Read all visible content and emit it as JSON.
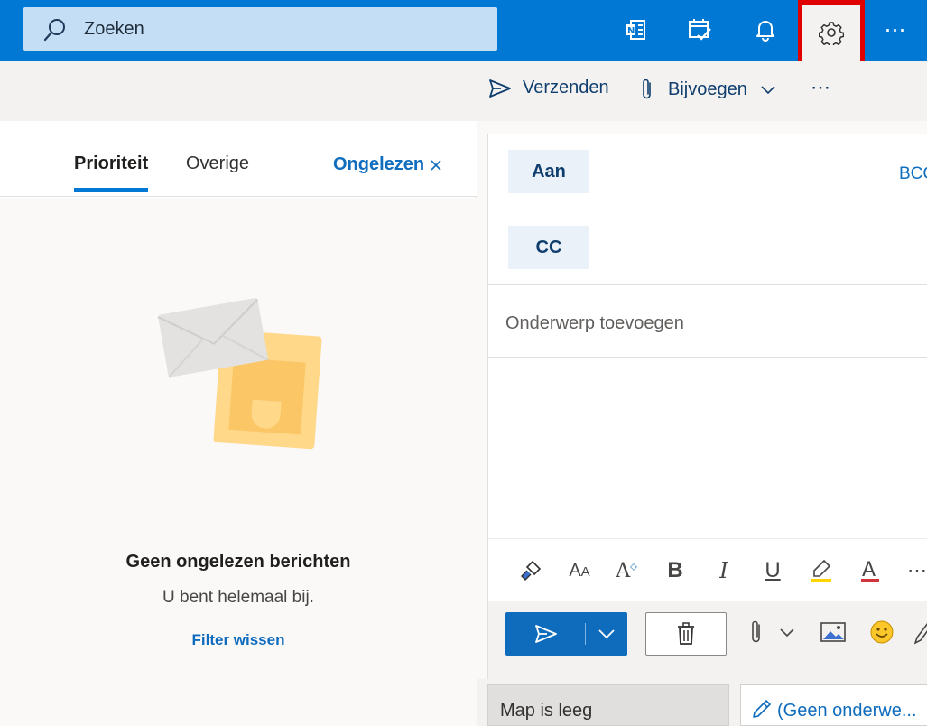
{
  "topbar": {
    "search_placeholder": "Zoeken",
    "icons": [
      "onenote-icon",
      "todo-icon",
      "bell-icon",
      "gear-icon",
      "more-icon"
    ]
  },
  "commandbar": {
    "send_label": "Verzenden",
    "attach_label": "Bijvoegen",
    "more_label": "⋯"
  },
  "leftpane": {
    "tabs": [
      {
        "label": "Prioriteit",
        "active": true
      },
      {
        "label": "Overige",
        "active": false
      }
    ],
    "filter_label": "Ongelezen",
    "empty_title": "Geen ongelezen berichten",
    "empty_subtitle": "U bent helemaal bij.",
    "clear_filter_link": "Filter wissen"
  },
  "compose": {
    "to_label": "Aan",
    "bcc_label": "BCC",
    "cc_label": "CC",
    "subject_placeholder": "Onderwerp toevoegen",
    "format_bold": "B",
    "format_italic": "I",
    "format_underline": "U",
    "format_more": "⋯"
  },
  "bottom": {
    "folder_empty": "Map is leeg",
    "draft_tab": "(Geen onderwe..."
  },
  "colors": {
    "brand_blue": "#0078d4",
    "link_blue": "#106ebe",
    "highlight_red": "#e00000"
  }
}
